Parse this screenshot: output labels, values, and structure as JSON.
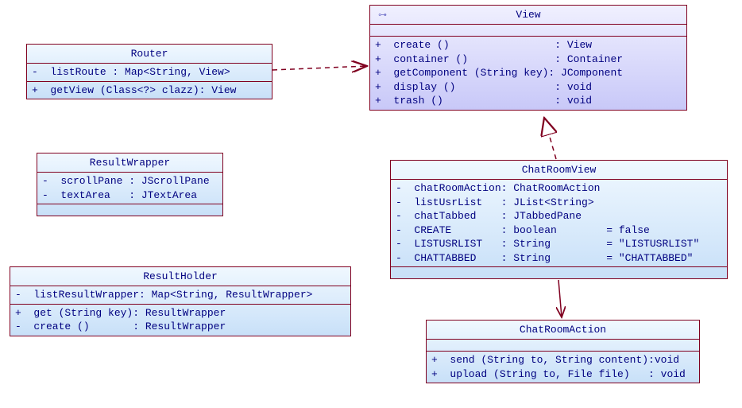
{
  "classes": {
    "router": {
      "name": "Router",
      "attrs": "-  listRoute : Map<String, View>",
      "ops": "+  getView (Class<?> clazz): View"
    },
    "view": {
      "name": "View",
      "ops": "+  create ()                 : View\n+  container ()              : Container\n+  getComponent (String key): JComponent\n+  display ()                : void\n+  trash ()                  : void"
    },
    "resultWrapper": {
      "name": "ResultWrapper",
      "attrs": "-  scrollPane : JScrollPane\n-  textArea   : JTextArea"
    },
    "chatRoomView": {
      "name": "ChatRoomView",
      "attrs": "-  chatRoomAction: ChatRoomAction\n-  listUsrList   : JList<String>\n-  chatTabbed    : JTabbedPane\n-  CREATE        : boolean        = false\n-  LISTUSRLIST   : String         = \"LISTUSRLIST\"\n-  CHATTABBED    : String         = \"CHATTABBED\""
    },
    "resultHolder": {
      "name": "ResultHolder",
      "attrs": "-  listResultWrapper: Map<String, ResultWrapper>",
      "ops": "+  get (String key): ResultWrapper\n-  create ()       : ResultWrapper"
    },
    "chatRoomAction": {
      "name": "ChatRoomAction",
      "ops": "+  send (String to, String content):void\n+  upload (String to, File file)   : void"
    }
  },
  "chart_data": [
    {
      "type": "uml-class",
      "name": "Router",
      "interface": false,
      "attributes": [
        {
          "visibility": "-",
          "name": "listRoute",
          "type": "Map<String, View>"
        }
      ],
      "operations": [
        {
          "visibility": "+",
          "signature": "getView(Class<?> clazz)",
          "returns": "View"
        }
      ]
    },
    {
      "type": "uml-class",
      "name": "View",
      "interface": true,
      "operations": [
        {
          "visibility": "+",
          "signature": "create()",
          "returns": "View"
        },
        {
          "visibility": "+",
          "signature": "container()",
          "returns": "Container"
        },
        {
          "visibility": "+",
          "signature": "getComponent(String key)",
          "returns": "JComponent"
        },
        {
          "visibility": "+",
          "signature": "display()",
          "returns": "void"
        },
        {
          "visibility": "+",
          "signature": "trash()",
          "returns": "void"
        }
      ]
    },
    {
      "type": "uml-class",
      "name": "ResultWrapper",
      "interface": false,
      "attributes": [
        {
          "visibility": "-",
          "name": "scrollPane",
          "type": "JScrollPane"
        },
        {
          "visibility": "-",
          "name": "textArea",
          "type": "JTextArea"
        }
      ]
    },
    {
      "type": "uml-class",
      "name": "ChatRoomView",
      "interface": false,
      "attributes": [
        {
          "visibility": "-",
          "name": "chatRoomAction",
          "type": "ChatRoomAction"
        },
        {
          "visibility": "-",
          "name": "listUsrList",
          "type": "JList<String>"
        },
        {
          "visibility": "-",
          "name": "chatTabbed",
          "type": "JTabbedPane"
        },
        {
          "visibility": "-",
          "name": "CREATE",
          "type": "boolean",
          "default": "false"
        },
        {
          "visibility": "-",
          "name": "LISTUSRLIST",
          "type": "String",
          "default": "\"LISTUSRLIST\""
        },
        {
          "visibility": "-",
          "name": "CHATTABBED",
          "type": "String",
          "default": "\"CHATTABBED\""
        }
      ]
    },
    {
      "type": "uml-class",
      "name": "ResultHolder",
      "interface": false,
      "attributes": [
        {
          "visibility": "-",
          "name": "listResultWrapper",
          "type": "Map<String, ResultWrapper>"
        }
      ],
      "operations": [
        {
          "visibility": "+",
          "signature": "get(String key)",
          "returns": "ResultWrapper"
        },
        {
          "visibility": "-",
          "signature": "create()",
          "returns": "ResultWrapper"
        }
      ]
    },
    {
      "type": "uml-class",
      "name": "ChatRoomAction",
      "interface": false,
      "operations": [
        {
          "visibility": "+",
          "signature": "send(String to, String content)",
          "returns": "void"
        },
        {
          "visibility": "+",
          "signature": "upload(String to, File file)",
          "returns": "void"
        }
      ]
    },
    {
      "type": "uml-relationship",
      "from": "Router",
      "to": "View",
      "kind": "dependency"
    },
    {
      "type": "uml-relationship",
      "from": "ChatRoomView",
      "to": "View",
      "kind": "realization"
    },
    {
      "type": "uml-relationship",
      "from": "ChatRoomAction",
      "to": "ChatRoomView",
      "kind": "association"
    }
  ]
}
